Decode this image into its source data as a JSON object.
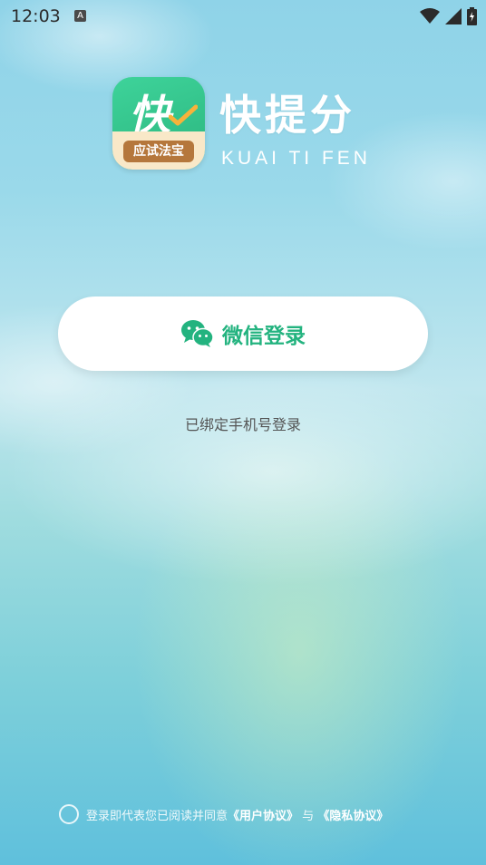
{
  "status_bar": {
    "time": "12:03",
    "a_icon_letter": "A",
    "icons": [
      "a-icon",
      "wifi-icon",
      "signal-icon",
      "battery-icon"
    ]
  },
  "logo": {
    "icon_char": "快",
    "icon_tag": "应试法宝",
    "app_name": "快提分",
    "app_name_en": "KUAI TI FEN"
  },
  "login": {
    "wechat_label": "微信登录",
    "phone_login_label": "已绑定手机号登录"
  },
  "agreement": {
    "prefix": "登录即代表您已阅读并同意",
    "user_agreement": "《用户协议》",
    "conjunction": "与",
    "privacy_agreement": "《隐私协议》"
  },
  "colors": {
    "accent": "#23b37f",
    "button_bg": "#ffffff",
    "logo_green": "#2bb57e"
  }
}
